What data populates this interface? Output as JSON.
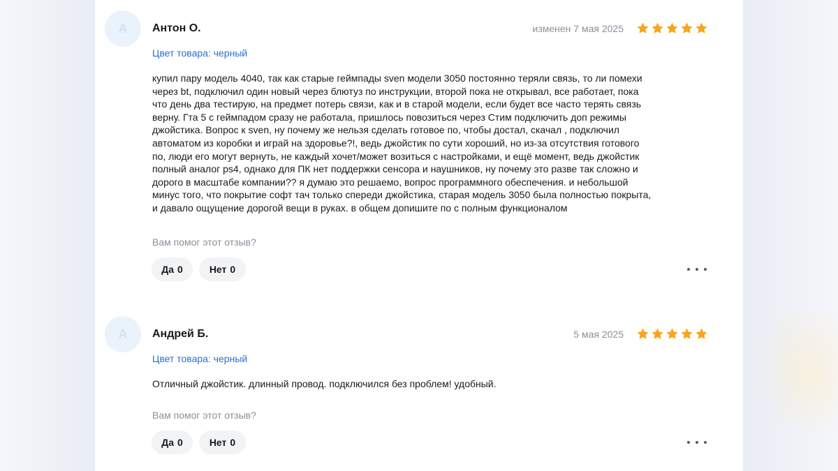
{
  "colors": {
    "accent_link": "#2a6fd6",
    "star": "#f8a51b",
    "muted_text": "#8a8f99",
    "button_bg": "#f2f3f5"
  },
  "reviews": [
    {
      "avatar_letter": "А",
      "author": "Антон О.",
      "date": "изменен 7 мая 2025",
      "rating": 5,
      "variant": "Цвет товара: черный",
      "text_lines": [
        "купил пару модель 4040, так как старые геймпады sven модели 3050 постоянно теряли связь, то ли помехи",
        "через bt, подключил один новый через блютуз по инструкции, второй пока не открывал, все работает, пока",
        "что день два тестирую, на предмет потерь связи, как и в старой модели, если будет все часто терять связь",
        "верну. Гта 5 с геймпадом сразу не работала, пришлось повозиться через Стим подключить доп режимы",
        "джойстика. Вопрос к sven, ну почему же нельзя сделать готовое по, чтобы достал, скачал , подключил",
        "автоматом из коробки и играй на здоровье?!, ведь джойстик по сути хороший, но из-за отсутствия готового",
        "по, люди его могут вернуть, не каждый хочет/может возиться с настройками, и ещё момент, ведь джойстик",
        "полный аналог ps4, однако для ПК нет поддержки сенсора и наушников, ну почему это разве так сложно и",
        "дорого в масштабе компании?? я думаю это решаемо, вопрос программного обеспечения. и небольшой",
        "минус того, что покрытие софт тач только спереди джойстика, старая модель 3050 была полностью покрыта,",
        "и давало ощущение дорогой вещи в руках. в общем допишите по с полным функционалом"
      ],
      "helpful_question": "Вам помог этот отзыв?",
      "yes_label": "Да",
      "yes_count": "0",
      "no_label": "Нет",
      "no_count": "0"
    },
    {
      "avatar_letter": "А",
      "author": "Андрей Б.",
      "date": "5 мая 2025",
      "rating": 5,
      "variant": "Цвет товара: черный",
      "text_lines": [
        "Отличный джойстик. длинный провод. подключился без проблем! удобный."
      ],
      "helpful_question": "Вам помог этот отзыв?",
      "yes_label": "Да",
      "yes_count": "0",
      "no_label": "Нет",
      "no_count": "0"
    }
  ]
}
